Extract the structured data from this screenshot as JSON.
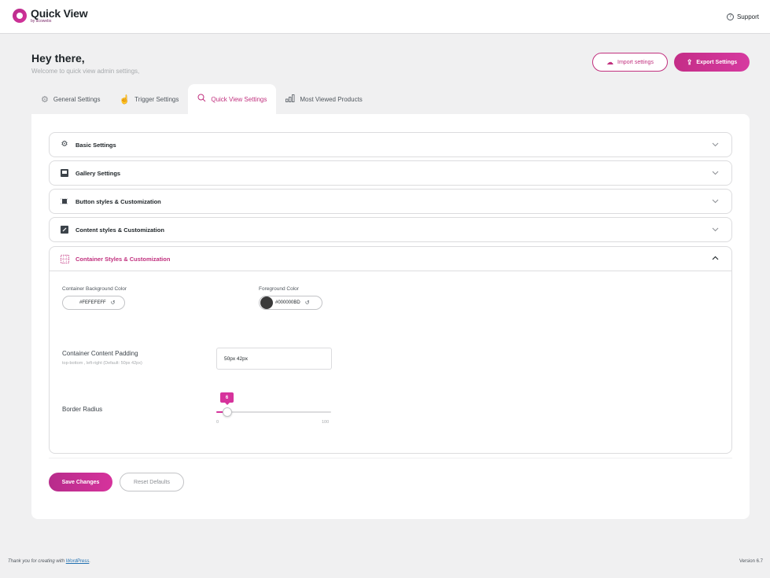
{
  "header": {
    "logo_title": "Quick View",
    "logo_subtitle": "by acowebs",
    "support_label": "Support"
  },
  "greeting": {
    "title": "Hey there,",
    "subtitle": "Welcome to quick view admin settings,"
  },
  "actions": {
    "import_label": "Import settings",
    "export_label": "Export Settings"
  },
  "tabs": [
    {
      "label": "General Settings",
      "icon": "gear-icon",
      "active": false
    },
    {
      "label": "Trigger Settings",
      "icon": "pointer-icon",
      "active": false
    },
    {
      "label": "Quick View Settings",
      "icon": "search-icon",
      "active": true
    },
    {
      "label": "Most Viewed Products",
      "icon": "bar-chart-icon",
      "active": false
    }
  ],
  "sections": [
    {
      "title": "Basic Settings",
      "icon": "gear-icon",
      "expanded": false
    },
    {
      "title": "Gallery Settings",
      "icon": "image-icon",
      "expanded": false
    },
    {
      "title": "Button styles & Customization",
      "icon": "button-icon",
      "expanded": false
    },
    {
      "title": "Content styles & Customization",
      "icon": "edit-icon",
      "expanded": false
    },
    {
      "title": "Container Styles & Customization",
      "icon": "grid-icon",
      "expanded": true
    }
  ],
  "container": {
    "bg_color_label": "Container Background Color",
    "bg_color_value": "#FEFEFEFF",
    "fg_color_label": "Foreground Color",
    "fg_color_value": "#000000BD",
    "padding_label": "Container Content Padding",
    "padding_hint": "top-bottom , left-right (Default: 50px 42px)",
    "padding_value": "50px 42px",
    "radius_label": "Border Radius",
    "radius_value": "6",
    "radius_min": "0",
    "radius_max": "100"
  },
  "footer_buttons": {
    "save_label": "Save Changes",
    "reset_label": "Reset Defaults"
  },
  "wp_footer": {
    "text": "Thank you for creating with",
    "link": "WordPress",
    "punct": ".",
    "version": "Version 6.7"
  },
  "colors": {
    "accent": "#c1307e",
    "accent_gradient_end": "#d6339c",
    "background": "#f0f0f1"
  }
}
